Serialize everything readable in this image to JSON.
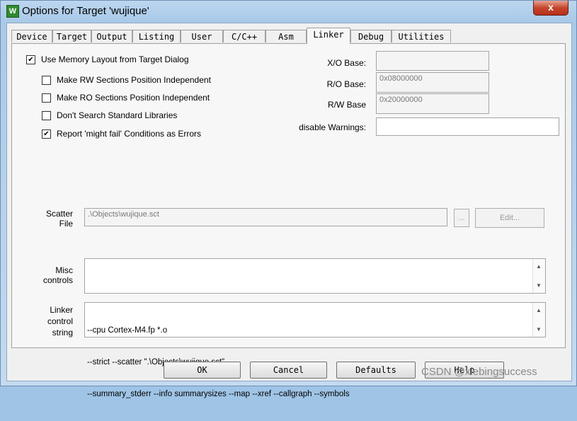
{
  "window": {
    "title": "Options for Target 'wujique'",
    "icon_letter": "W",
    "close_label": "x"
  },
  "tabs": [
    {
      "label": "Device"
    },
    {
      "label": "Target"
    },
    {
      "label": "Output"
    },
    {
      "label": "Listing"
    },
    {
      "label": "User"
    },
    {
      "label": "C/C++"
    },
    {
      "label": "Asm"
    },
    {
      "label": "Linker"
    },
    {
      "label": "Debug"
    },
    {
      "label": "Utilities"
    }
  ],
  "active_tab": "Linker",
  "options": {
    "use_memory_layout": {
      "label": "Use Memory Layout from Target Dialog",
      "checked": true
    },
    "rw_independent": {
      "label": "Make RW Sections Position Independent",
      "checked": false
    },
    "ro_independent": {
      "label": "Make RO Sections Position Independent",
      "checked": false
    },
    "dont_search_libs": {
      "label": "Don't Search Standard Libraries",
      "checked": false
    },
    "report_might_fail": {
      "label": "Report 'might fail' Conditions as Errors",
      "checked": true
    }
  },
  "fields": {
    "xo_base": {
      "label": "X/O Base:",
      "value": ""
    },
    "ro_base": {
      "label": "R/O Base:",
      "value": "0x08000000"
    },
    "rw_base": {
      "label": "R/W Base",
      "value": "0x20000000"
    },
    "disable_warnings": {
      "label": "disable Warnings:",
      "value": ""
    }
  },
  "scatter": {
    "label_line1": "Scatter",
    "label_line2": "File",
    "value": ".\\Objects\\wujique.sct",
    "browse_label": "...",
    "edit_label": "Edit..."
  },
  "misc": {
    "label_line1": "Misc",
    "label_line2": "controls",
    "value": ""
  },
  "linker_control": {
    "label_line1": "Linker",
    "label_line2": "control",
    "label_line3": "string",
    "line1": "--cpu Cortex-M4.fp *.o",
    "line2": "--strict --scatter \".\\Objects\\wujique.sct\"",
    "line3": "--summary_stderr --info summarysizes --map --xref --callgraph --symbols"
  },
  "buttons": {
    "ok": "OK",
    "cancel": "Cancel",
    "defaults": "Defaults",
    "help": "Help"
  },
  "watermark": "CSDN @xiebingsuccess",
  "icons": {
    "check": "✔",
    "up": "▲",
    "down": "▼"
  }
}
